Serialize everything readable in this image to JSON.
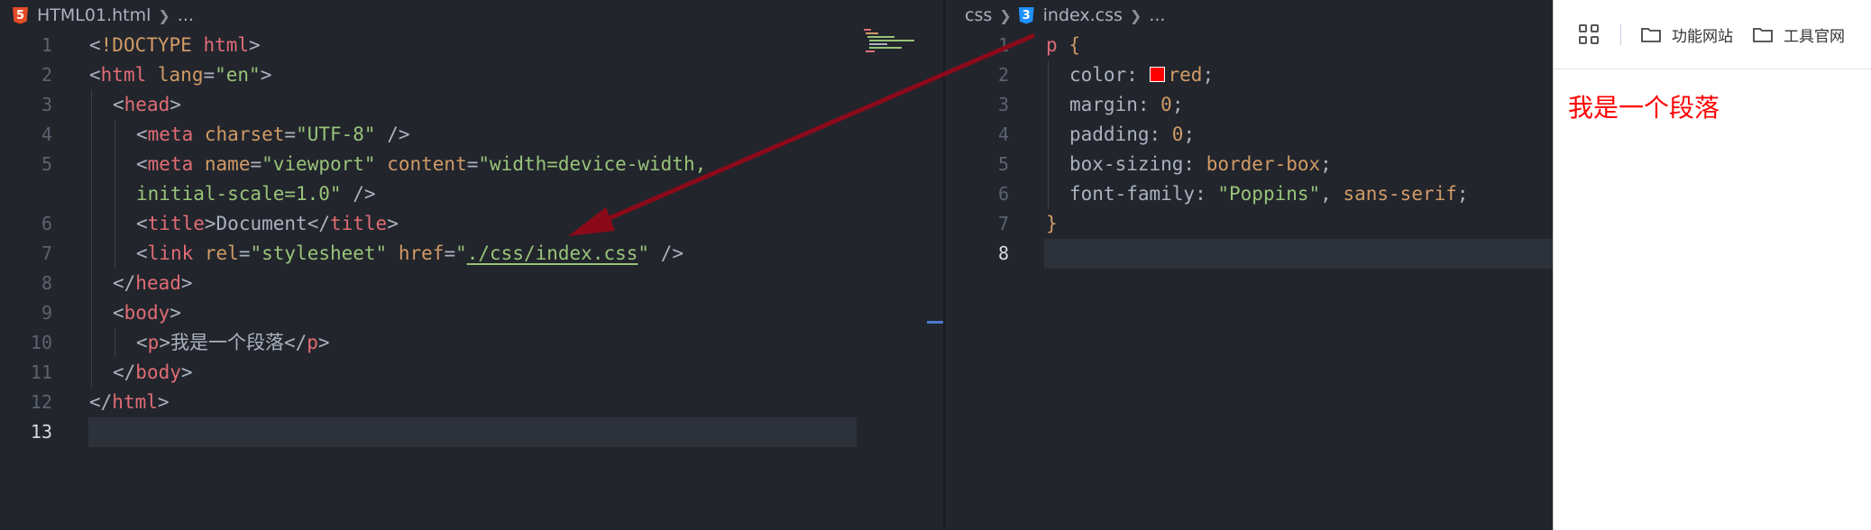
{
  "left_editor": {
    "breadcrumb": {
      "file": "HTML01.html",
      "ellipsis": "...",
      "icon": "html5-icon"
    },
    "lines": [
      {
        "n": "1",
        "tokens": [
          [
            "t-punct",
            "<"
          ],
          [
            "t-attr",
            "!DOCTYPE"
          ],
          [
            "t-punct",
            " "
          ],
          [
            "t-tag",
            "html"
          ],
          [
            "t-punct",
            ">"
          ]
        ]
      },
      {
        "n": "2",
        "tokens": [
          [
            "t-punct",
            "<"
          ],
          [
            "t-tag",
            "html"
          ],
          [
            "t-punct",
            " "
          ],
          [
            "t-attr",
            "lang"
          ],
          [
            "t-punct",
            "="
          ],
          [
            "t-str",
            "\"en\""
          ],
          [
            "t-punct",
            ">"
          ]
        ]
      },
      {
        "n": "3",
        "indent": 1,
        "tokens": [
          [
            "t-punct",
            "<"
          ],
          [
            "t-tag",
            "head"
          ],
          [
            "t-punct",
            ">"
          ]
        ]
      },
      {
        "n": "4",
        "indent": 2,
        "tokens": [
          [
            "t-punct",
            "<"
          ],
          [
            "t-tag",
            "meta"
          ],
          [
            "t-punct",
            " "
          ],
          [
            "t-attr",
            "charset"
          ],
          [
            "t-punct",
            "="
          ],
          [
            "t-str",
            "\"UTF-8\""
          ],
          [
            "t-punct",
            " />"
          ]
        ]
      },
      {
        "n": "5",
        "indent": 2,
        "tokens": [
          [
            "t-punct",
            "<"
          ],
          [
            "t-tag",
            "meta"
          ],
          [
            "t-punct",
            " "
          ],
          [
            "t-attr",
            "name"
          ],
          [
            "t-punct",
            "="
          ],
          [
            "t-str",
            "\"viewport\""
          ],
          [
            "t-punct",
            " "
          ],
          [
            "t-attr",
            "content"
          ],
          [
            "t-punct",
            "="
          ],
          [
            "t-str",
            "\"width=device-width,"
          ]
        ]
      },
      {
        "n": "",
        "indent": 2,
        "tokens": [
          [
            "t-str",
            "initial-scale=1.0\""
          ],
          [
            "t-punct",
            " />"
          ]
        ]
      },
      {
        "n": "6",
        "indent": 2,
        "tokens": [
          [
            "t-punct",
            "<"
          ],
          [
            "t-tag",
            "title"
          ],
          [
            "t-punct",
            ">"
          ],
          [
            "t-text",
            "Document"
          ],
          [
            "t-punct",
            "</"
          ],
          [
            "t-tag",
            "title"
          ],
          [
            "t-punct",
            ">"
          ]
        ]
      },
      {
        "n": "7",
        "indent": 2,
        "tokens": [
          [
            "t-punct",
            "<"
          ],
          [
            "t-tag",
            "link"
          ],
          [
            "t-punct",
            " "
          ],
          [
            "t-attr",
            "rel"
          ],
          [
            "t-punct",
            "="
          ],
          [
            "t-str",
            "\"stylesheet\""
          ],
          [
            "t-punct",
            " "
          ],
          [
            "t-attr",
            "href"
          ],
          [
            "t-punct",
            "="
          ],
          [
            "t-str",
            "\""
          ],
          [
            "t-link",
            "./css/index.css"
          ],
          [
            "t-str",
            "\""
          ],
          [
            "t-punct",
            " />"
          ]
        ]
      },
      {
        "n": "8",
        "indent": 1,
        "tokens": [
          [
            "t-punct",
            "</"
          ],
          [
            "t-tag",
            "head"
          ],
          [
            "t-punct",
            ">"
          ]
        ]
      },
      {
        "n": "9",
        "indent": 1,
        "tokens": [
          [
            "t-punct",
            "<"
          ],
          [
            "t-tag",
            "body"
          ],
          [
            "t-punct",
            ">"
          ]
        ]
      },
      {
        "n": "10",
        "indent": 2,
        "tokens": [
          [
            "t-punct",
            "<"
          ],
          [
            "t-tag",
            "p"
          ],
          [
            "t-punct",
            ">"
          ],
          [
            "t-text",
            "我是一个段落"
          ],
          [
            "t-punct",
            "</"
          ],
          [
            "t-tag",
            "p"
          ],
          [
            "t-punct",
            ">"
          ]
        ]
      },
      {
        "n": "11",
        "indent": 1,
        "tokens": [
          [
            "t-punct",
            "</"
          ],
          [
            "t-tag",
            "body"
          ],
          [
            "t-punct",
            ">"
          ]
        ]
      },
      {
        "n": "12",
        "tokens": [
          [
            "t-punct",
            "</"
          ],
          [
            "t-tag",
            "html"
          ],
          [
            "t-punct",
            ">"
          ]
        ]
      },
      {
        "n": "13",
        "current": true,
        "tokens": []
      }
    ]
  },
  "right_editor": {
    "breadcrumb": {
      "folder": "css",
      "file": "index.css",
      "ellipsis": "...",
      "icon": "css3-icon"
    },
    "lines": [
      {
        "n": "1",
        "tokens": [
          [
            "t-sel",
            "p"
          ],
          [
            "t-punct",
            " "
          ],
          [
            "t-brace",
            "{"
          ]
        ]
      },
      {
        "n": "2",
        "indent": 1,
        "tokens": [
          [
            "t-prop",
            "color: "
          ],
          [
            "swatch",
            "#ff0000"
          ],
          [
            "t-val",
            "red"
          ],
          [
            "t-punct",
            ";"
          ]
        ]
      },
      {
        "n": "3",
        "indent": 1,
        "tokens": [
          [
            "t-prop",
            "margin: "
          ],
          [
            "t-num",
            "0"
          ],
          [
            "t-punct",
            ";"
          ]
        ]
      },
      {
        "n": "4",
        "indent": 1,
        "tokens": [
          [
            "t-prop",
            "padding: "
          ],
          [
            "t-num",
            "0"
          ],
          [
            "t-punct",
            ";"
          ]
        ]
      },
      {
        "n": "5",
        "indent": 1,
        "tokens": [
          [
            "t-prop",
            "box-sizing: "
          ],
          [
            "t-val",
            "border-box"
          ],
          [
            "t-punct",
            ";"
          ]
        ]
      },
      {
        "n": "6",
        "indent": 1,
        "tokens": [
          [
            "t-prop",
            "font-family: "
          ],
          [
            "t-str",
            "\"Poppins\""
          ],
          [
            "t-punct",
            ", "
          ],
          [
            "t-val",
            "sans-serif"
          ],
          [
            "t-punct",
            ";"
          ]
        ]
      },
      {
        "n": "7",
        "tokens": [
          [
            "t-brace",
            "}"
          ]
        ]
      },
      {
        "n": "8",
        "current": true,
        "tokens": []
      }
    ]
  },
  "browser": {
    "bookmarks": [
      {
        "label": "功能网站",
        "icon": "folder-icon"
      },
      {
        "label": "工具官网",
        "icon": "folder-icon"
      }
    ],
    "paragraph": "我是一个段落",
    "paragraph_color": "#ff0000"
  },
  "colors": {
    "editor_bg": "#22252c",
    "annotation_arrow": "#8b0a1a"
  }
}
